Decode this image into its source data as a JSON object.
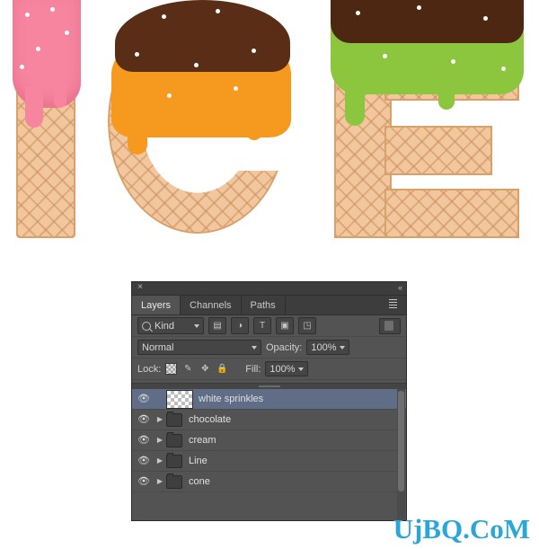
{
  "artwork": {
    "title": "ICE",
    "letters": [
      {
        "char": "I",
        "topping": "pink strawberry drip",
        "cone": "waffle"
      },
      {
        "char": "C",
        "topping": "chocolate and orange drip",
        "cone": "waffle"
      },
      {
        "char": "E",
        "topping": "chocolate and green drip",
        "cone": "waffle"
      }
    ],
    "colors": {
      "waffle": "#f3c79d",
      "waffle_line": "#c98d5d",
      "pink": "#f7859f",
      "orange": "#f59a1e",
      "chocolate": "#5a2d17",
      "green": "#8cc63e",
      "sprinkle": "#ffffff"
    }
  },
  "panel": {
    "close_icon": "×",
    "collapse_icon": "«",
    "menu_icon": "panel-menu-icon",
    "tabs": [
      {
        "label": "Layers",
        "active": true
      },
      {
        "label": "Channels",
        "active": false
      },
      {
        "label": "Paths",
        "active": false
      }
    ],
    "filter": {
      "kind_label": "Kind",
      "search_icon": "search-icon",
      "icons": [
        "pixel-layer-filter",
        "adjustment-layer-filter",
        "type-layer-filter",
        "shape-layer-filter",
        "smart-object-filter"
      ],
      "toggle": "filter-enable-toggle"
    },
    "blend": {
      "mode": "Normal",
      "opacity_label": "Opacity:",
      "opacity_value": "100%"
    },
    "lock": {
      "label": "Lock:",
      "icons": [
        "lock-transparent-pixels",
        "lock-image-pixels",
        "lock-position",
        "lock-all"
      ],
      "fill_label": "Fill:",
      "fill_value": "100%"
    },
    "layers": [
      {
        "name": "white sprinkles",
        "type": "pixel",
        "visible": true,
        "selected": true,
        "expandable": false
      },
      {
        "name": "chocolate",
        "type": "group",
        "visible": true,
        "selected": false,
        "expandable": true
      },
      {
        "name": "cream",
        "type": "group",
        "visible": true,
        "selected": false,
        "expandable": true
      },
      {
        "name": "Line",
        "type": "group",
        "visible": true,
        "selected": false,
        "expandable": true
      },
      {
        "name": "cone",
        "type": "group",
        "visible": true,
        "selected": false,
        "expandable": true
      }
    ],
    "eye_icon": "👁",
    "disclosure_icon": "▶"
  },
  "watermark": {
    "text": "UjBQ.CoM",
    "color": "#2aa7d8"
  }
}
